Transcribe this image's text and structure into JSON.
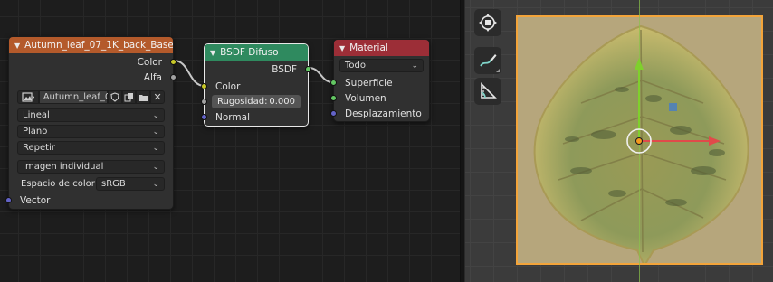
{
  "image_node": {
    "title": "Autumn_leaf_07_1K_back_Base_Color...",
    "outputs": {
      "color": "Color",
      "alpha": "Alfa"
    },
    "image_name": "Autumn_leaf_07...",
    "interpolation": "Lineal",
    "projection": "Plano",
    "extension": "Repetir",
    "source": "Imagen individual",
    "color_space_label": "Espacio de color",
    "color_space_value": "sRGB",
    "vector_input": "Vector",
    "header_color": "#b45a2b"
  },
  "bsdf_node": {
    "title": "BSDF Difuso",
    "output": "BSDF",
    "color_input": "Color",
    "roughness_label": "Rugosidad:",
    "roughness_value": "0.000",
    "normal_input": "Normal",
    "header_color": "#2f8a5f"
  },
  "material_node": {
    "title": "Material",
    "target": "Todo",
    "surface": "Superficie",
    "volume": "Volumen",
    "displacement": "Desplazamiento",
    "header_color": "#9c2e37"
  },
  "viewport": {
    "tools": [
      "transform-icon",
      "annotate-icon",
      "measure-icon"
    ],
    "selection_color": "#f3a43a"
  }
}
